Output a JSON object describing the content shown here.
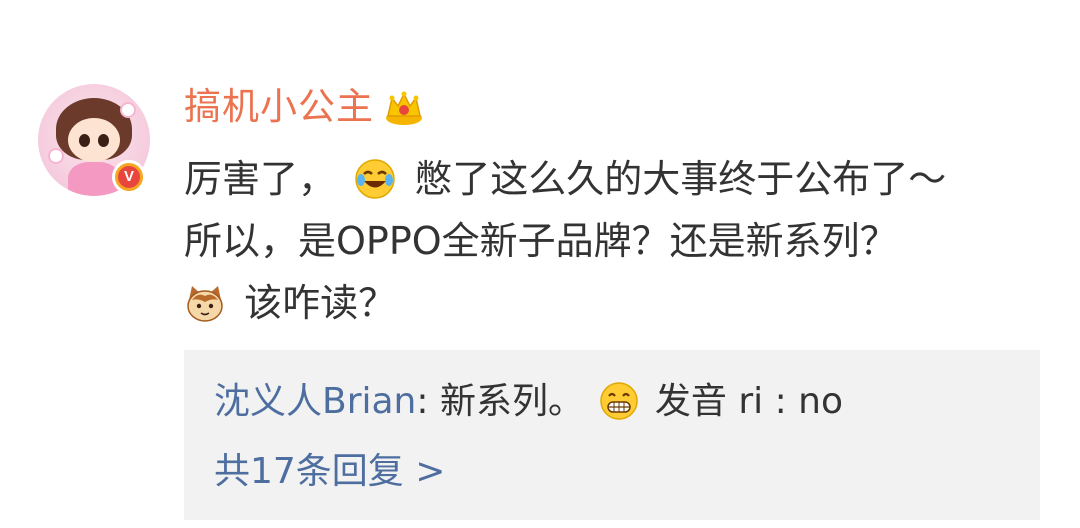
{
  "comment": {
    "username": "搞机小公主",
    "verified_badge": "V",
    "icons": {
      "avatar": "avatar-girl-illustration",
      "verified": "verified-v-badge-icon",
      "crown": "crown-icon",
      "laugh_cry": "laugh-cry-emoji-icon",
      "cat": "cat-emoji-icon",
      "grin": "grin-emoji-icon"
    },
    "text_part1": "厉害了，",
    "text_part2": "憋了这么久的大事终于公布了～",
    "text_line2": "所以，是OPPO全新子品牌？还是新系列？",
    "text_line3": "该咋读？"
  },
  "reply": {
    "user": "沈义人Brian",
    "text_part1": ": 新系列。",
    "text_part2": "发音 ri : no",
    "more_link": "共17条回复 >"
  },
  "colors": {
    "username": "#eb7350",
    "link": "#4e6ea0",
    "text": "#333333",
    "reply_bg": "#f2f2f2"
  }
}
